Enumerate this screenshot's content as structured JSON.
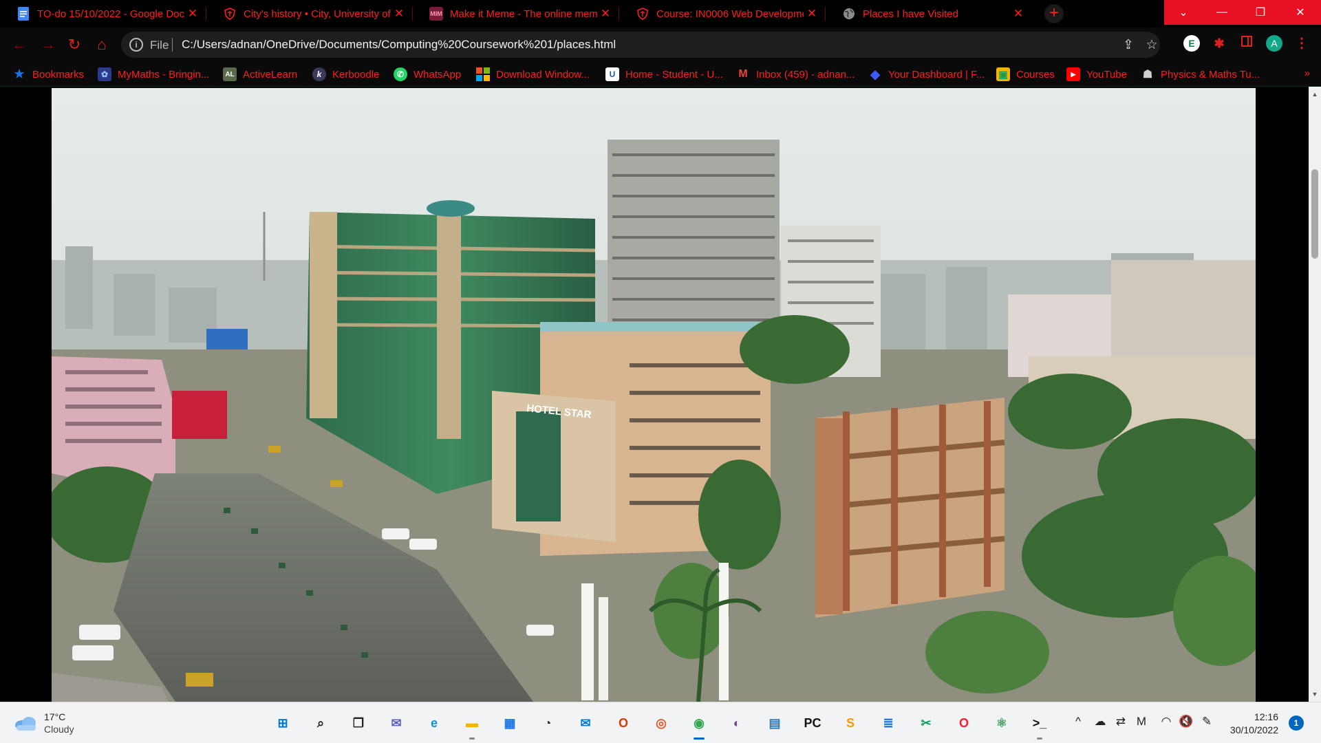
{
  "browser": {
    "tabs": [
      {
        "title": "TO-do 15/10/2022 - Google Doc",
        "icon": "google-docs-icon",
        "icon_color": "#4285f4",
        "active": false
      },
      {
        "title": "City's history • City, University of",
        "icon": "city-crest-icon",
        "icon_color": "#ff1e1e",
        "active": false
      },
      {
        "title": "Make it Meme - The online mem",
        "icon": "mim-icon",
        "icon_glyph": "MIM",
        "icon_color": "#7a1b3a",
        "active": false
      },
      {
        "title": "Course: IN0006 Web Developme",
        "icon": "city-crest-icon",
        "icon_color": "#ff1e1e",
        "active": false
      },
      {
        "title": "Places I have Visited",
        "icon": "globe-icon",
        "icon_color": "#9a9a9a",
        "active": true
      }
    ],
    "new_tab_glyph": "+",
    "window_controls": {
      "dropdown": "⌄",
      "minimize": "—",
      "restore": "❐",
      "close": "✕"
    },
    "address": {
      "scheme": "File",
      "url": "C:/Users/adnan/OneDrive/Documents/Computing%20Coursework%201/places.html"
    },
    "nav": {
      "back": "←",
      "forward": "→",
      "reload": "↻",
      "home": "⌂"
    },
    "profile_initial": "A",
    "extension_e_glyph": "E",
    "bookmarks": [
      {
        "label": "Bookmarks",
        "icon": "star-icon",
        "glyph": "★",
        "color": "#1a73e8"
      },
      {
        "label": "MyMaths - Bringin...",
        "icon": "mymaths-icon",
        "glyph": "✿",
        "color": "#2a3a8c"
      },
      {
        "label": "ActiveLearn",
        "icon": "activelearn-icon",
        "glyph": "AL",
        "color": "#5a6a4a"
      },
      {
        "label": "Kerboodle",
        "icon": "kerboodle-icon",
        "glyph": "k",
        "color": "#3a3a5a"
      },
      {
        "label": "WhatsApp",
        "icon": "whatsapp-icon",
        "glyph": "✆",
        "color": "#25d366"
      },
      {
        "label": "Download Window...",
        "icon": "microsoft-icon",
        "glyph": "",
        "color": "#f25022"
      },
      {
        "label": "Home - Student - U...",
        "icon": "unifrog-icon",
        "glyph": "U",
        "color": "#ffffff"
      },
      {
        "label": "Inbox (459) - adnan...",
        "icon": "gmail-icon",
        "glyph": "M",
        "color": "#ffffff"
      },
      {
        "label": "Your Dashboard | F...",
        "icon": "diamond-icon",
        "glyph": "◆",
        "color": "#3d5afe"
      },
      {
        "label": "Courses",
        "icon": "classroom-icon",
        "glyph": "▣",
        "color": "#f4b400"
      },
      {
        "label": "YouTube",
        "icon": "youtube-icon",
        "glyph": "▶",
        "color": "#ff0000"
      },
      {
        "label": "Physics & Maths Tu...",
        "icon": "pmt-icon",
        "glyph": "☗",
        "color": "#9a9a9a"
      }
    ],
    "bookmarks_more": "»"
  },
  "page": {
    "photo_alt": "City skyline with hotel buildings and busy street",
    "hotel_sign": "HOTEL STAR"
  },
  "taskbar": {
    "weather": {
      "temp": "17°C",
      "condition": "Cloudy"
    },
    "apps": [
      {
        "name": "windows-start-icon",
        "glyph": "⊞",
        "color": "#0078d4"
      },
      {
        "name": "search-icon",
        "glyph": "⌕",
        "color": "#222222"
      },
      {
        "name": "task-view-icon",
        "glyph": "❐",
        "color": "#222222"
      },
      {
        "name": "teams-chat-icon",
        "glyph": "✉",
        "color": "#5b5fc7"
      },
      {
        "name": "edge-icon",
        "glyph": "e",
        "color": "#0f8fd8"
      },
      {
        "name": "file-explorer-icon",
        "glyph": "▬",
        "color": "#f4b400"
      },
      {
        "name": "microsoft-store-icon",
        "glyph": "▦",
        "color": "#1a73e8"
      },
      {
        "name": "speedometer-icon",
        "glyph": "◔",
        "color": "#333333"
      },
      {
        "name": "mail-icon",
        "glyph": "✉",
        "color": "#0078d4"
      },
      {
        "name": "office-icon",
        "glyph": "O",
        "color": "#d83b01"
      },
      {
        "name": "ubuntu-icon",
        "glyph": "◎",
        "color": "#e95420"
      },
      {
        "name": "chrome-icon",
        "glyph": "◉",
        "color": "#34a853",
        "active": true
      },
      {
        "name": "tor-browser-icon",
        "glyph": "◐",
        "color": "#7d4698"
      },
      {
        "name": "python-file-icon",
        "glyph": "▤",
        "color": "#3776ab"
      },
      {
        "name": "pycharm-icon",
        "glyph": "PC",
        "color": "#111111"
      },
      {
        "name": "sublime-text-icon",
        "glyph": "S",
        "color": "#ff9800"
      },
      {
        "name": "notepad-icon",
        "glyph": "≣",
        "color": "#1a73e8"
      },
      {
        "name": "snipping-tool-icon",
        "glyph": "✂",
        "color": "#0f9d58"
      },
      {
        "name": "opera-icon",
        "glyph": "O",
        "color": "#ff1b2d"
      },
      {
        "name": "atom-icon",
        "glyph": "⚛",
        "color": "#40a060"
      },
      {
        "name": "terminal-icon",
        "glyph": ">_",
        "color": "#111111"
      }
    ],
    "tray": [
      {
        "name": "chevron-up-icon",
        "glyph": "^"
      },
      {
        "name": "onedrive-icon",
        "glyph": "☁"
      },
      {
        "name": "network-usb-icon",
        "glyph": "⇄"
      },
      {
        "name": "media-icon",
        "glyph": "M"
      },
      {
        "name": "wifi-icon",
        "glyph": "◠"
      },
      {
        "name": "volume-mute-icon",
        "glyph": "🔇"
      },
      {
        "name": "pen-icon",
        "glyph": "✎"
      }
    ],
    "time": "12:16",
    "date": "30/10/2022",
    "notifications": "1"
  }
}
